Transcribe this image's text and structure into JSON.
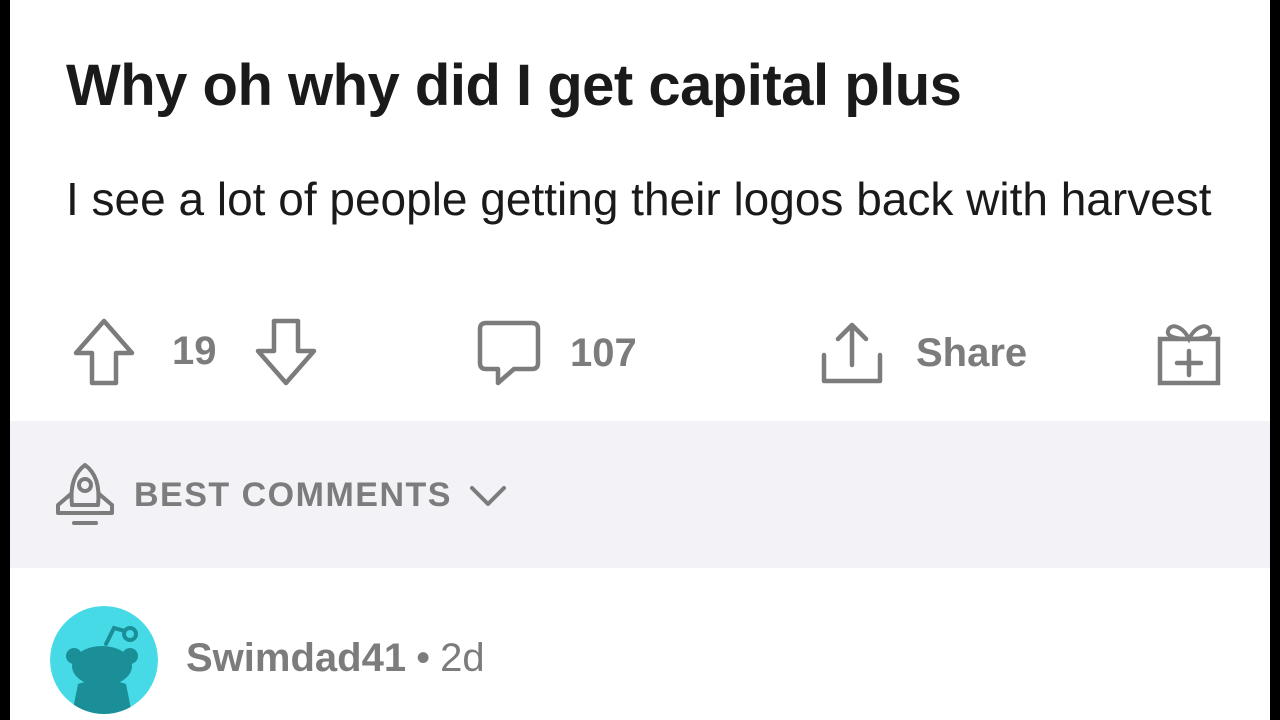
{
  "post": {
    "title": "Why oh why did I get capital plus",
    "body": "I see a lot of people getting their logos back with harvest"
  },
  "actions": {
    "upvote_icon": "upvote-arrow-icon",
    "vote_count": "19",
    "downvote_icon": "downvote-arrow-icon",
    "comment_icon": "speech-bubble-icon",
    "comment_count": "107",
    "share_icon": "share-upload-icon",
    "share_label": "Share",
    "award_icon": "gift-box-icon"
  },
  "comments_sort": {
    "icon": "rocket-icon",
    "label": "BEST COMMENTS",
    "chevron": "chevron-down-icon"
  },
  "comment": {
    "author": "Swimdad41",
    "separator": "•",
    "age": "2d",
    "avatar_color": "#46d9e6",
    "avatar_figure_color": "#1a8f97"
  },
  "colors": {
    "text_primary": "#1a1a1b",
    "text_muted": "#7c7c7c",
    "sort_bar_bg": "#f2f2f7"
  }
}
